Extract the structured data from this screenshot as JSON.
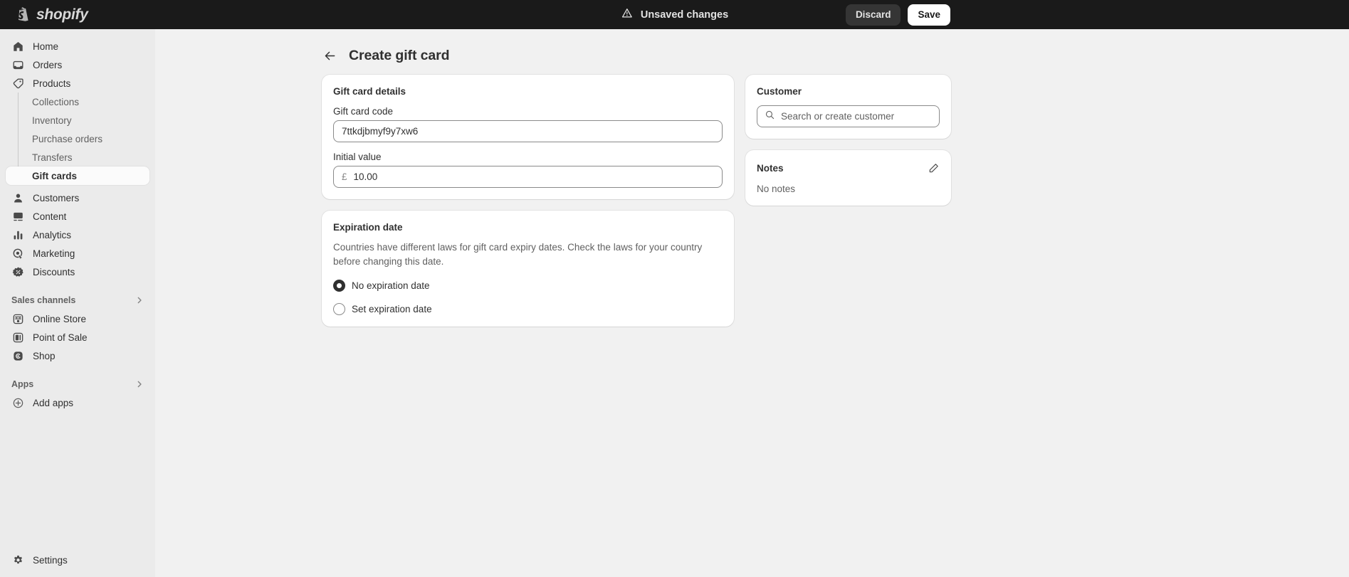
{
  "topbar": {
    "brand": "shopify",
    "brand_icon": "shopify-bag-logo",
    "unsaved_icon": "warning-triangle-icon",
    "unsaved_label": "Unsaved changes",
    "discard_label": "Discard",
    "save_label": "Save",
    "background": "#1a1a1a",
    "save_bg": "#ffffff",
    "discard_bg": "#353535"
  },
  "sidebar": {
    "background": "#ebebeb",
    "items": [
      {
        "label": "Home",
        "icon": "home-icon"
      },
      {
        "label": "Orders",
        "icon": "orders-inbox-icon"
      },
      {
        "label": "Products",
        "icon": "products-tag-icon"
      }
    ],
    "product_subitems": [
      {
        "label": "Collections",
        "active": false
      },
      {
        "label": "Inventory",
        "active": false
      },
      {
        "label": "Purchase orders",
        "active": false
      },
      {
        "label": "Transfers",
        "active": false
      },
      {
        "label": "Gift cards",
        "active": true
      }
    ],
    "items_after": [
      {
        "label": "Customers",
        "icon": "customers-person-icon"
      },
      {
        "label": "Content",
        "icon": "content-image-icon"
      },
      {
        "label": "Analytics",
        "icon": "analytics-bars-icon"
      },
      {
        "label": "Marketing",
        "icon": "marketing-target-icon"
      },
      {
        "label": "Discounts",
        "icon": "discounts-badge-icon"
      }
    ],
    "sales_channels": {
      "heading": "Sales channels",
      "chevron_icon": "chevron-right-icon",
      "items": [
        {
          "label": "Online Store",
          "icon": "online-store-icon"
        },
        {
          "label": "Point of Sale",
          "icon": "point-of-sale-icon"
        },
        {
          "label": "Shop",
          "icon": "shop-icon"
        }
      ]
    },
    "apps": {
      "heading": "Apps",
      "chevron_icon": "chevron-right-icon",
      "items": [
        {
          "label": "Add apps",
          "icon": "plus-circle-icon"
        }
      ]
    },
    "settings": {
      "label": "Settings",
      "icon": "gear-icon"
    }
  },
  "page": {
    "back_icon": "back-arrow-icon",
    "title": "Create gift card"
  },
  "gift_card_details": {
    "title": "Gift card details",
    "code_label": "Gift card code",
    "code_value": "7ttkdjbmyf9y7xw6",
    "value_label": "Initial value",
    "currency_symbol": "£",
    "value_amount": "10.00"
  },
  "expiration": {
    "title": "Expiration date",
    "help_text": "Countries have different laws for gift card expiry dates. Check the laws for your country before changing this date.",
    "options": [
      {
        "label": "No expiration date",
        "selected": true
      },
      {
        "label": "Set expiration date",
        "selected": false
      }
    ]
  },
  "customer": {
    "title": "Customer",
    "search_icon": "search-icon",
    "search_placeholder": "Search or create customer"
  },
  "notes": {
    "title": "Notes",
    "edit_icon": "pencil-edit-icon",
    "empty_text": "No notes"
  }
}
